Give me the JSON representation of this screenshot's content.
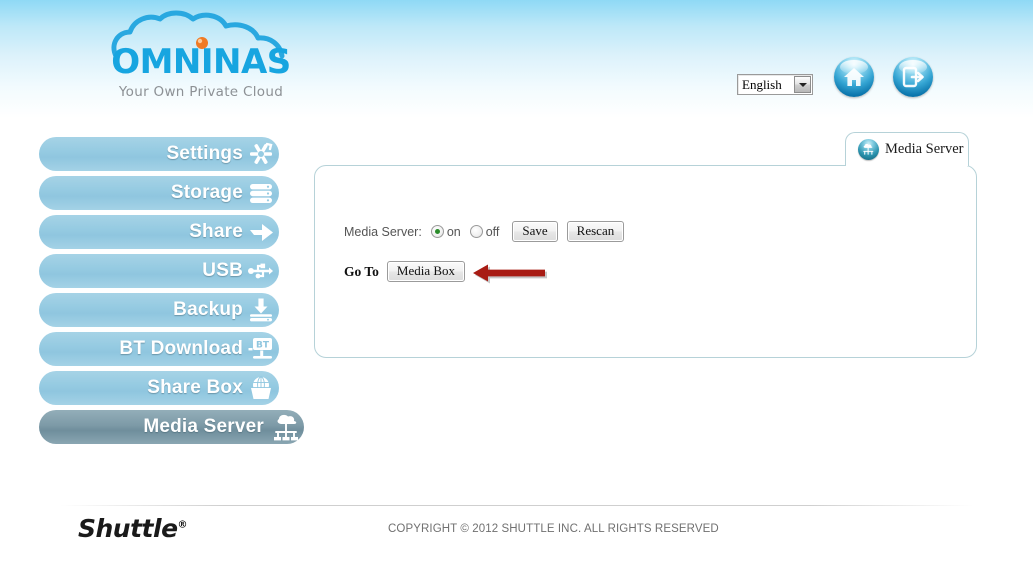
{
  "brand": {
    "logo_name": "OMNINAS",
    "tagline": "Your Own Private Cloud"
  },
  "header": {
    "language": {
      "selected": "English",
      "options": [
        "English"
      ]
    },
    "home_button_title": "Home",
    "logout_button_title": "Logout"
  },
  "sidebar": {
    "items": [
      {
        "label": "Settings",
        "icon": "settings-icon",
        "selected": false
      },
      {
        "label": "Storage",
        "icon": "storage-icon",
        "selected": false
      },
      {
        "label": "Share",
        "icon": "share-icon",
        "selected": false
      },
      {
        "label": "USB",
        "icon": "usb-icon",
        "selected": false
      },
      {
        "label": "Backup",
        "icon": "backup-icon",
        "selected": false
      },
      {
        "label": "BT Download",
        "icon": "bt-download-icon",
        "selected": false
      },
      {
        "label": "Share Box",
        "icon": "share-box-icon",
        "selected": false
      },
      {
        "label": "Media Server",
        "icon": "media-server-icon",
        "selected": true
      }
    ]
  },
  "tab": {
    "label": "Media Server",
    "icon": "media-server-tab-icon"
  },
  "panel": {
    "media_server": {
      "label": "Media Server:",
      "on_label": "on",
      "off_label": "off",
      "value": "on",
      "save_label": "Save",
      "rescan_label": "Rescan"
    },
    "goto": {
      "label": "Go To",
      "button_label": "Media Box"
    },
    "annotation": {
      "name": "red-arrow-pointer",
      "color": "#a81c14",
      "points_to": "Media Box"
    }
  },
  "footer": {
    "logo": "Shuttle",
    "logo_mark": "®",
    "copyright": "COPYRIGHT © 2012 SHUTTLE INC. ALL RIGHTS RESERVED"
  },
  "colors": {
    "header_gradient_top": "#8fd9f5",
    "brand_blue": "#17a5e0",
    "nav_blue": "#96cbe2",
    "nav_selected": "#7d9aa7",
    "panel_border": "#b6d2d8",
    "annotation_red": "#a81c14"
  }
}
